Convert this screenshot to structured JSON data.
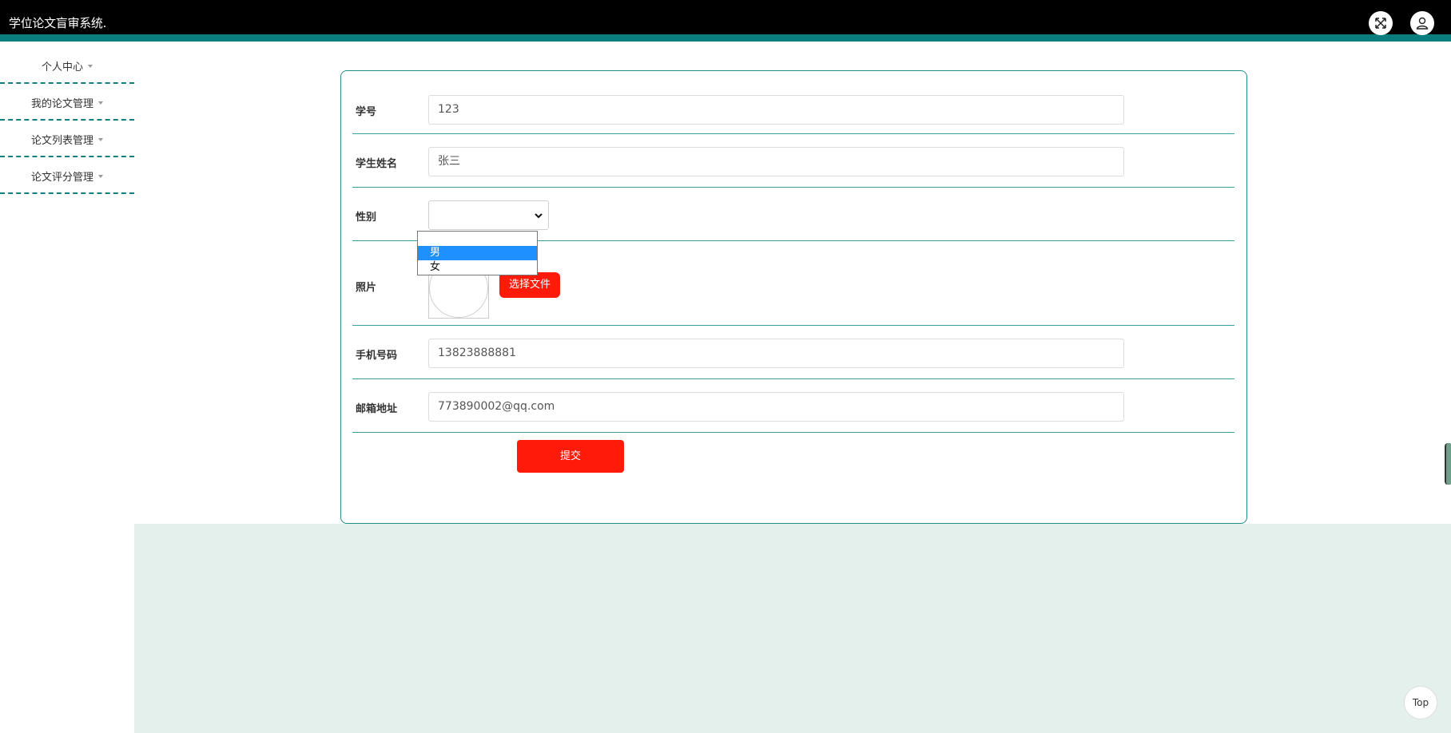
{
  "header": {
    "title": "学位论文盲审系统.",
    "icons": [
      "fullscreen-icon",
      "user-icon"
    ]
  },
  "sidebar": {
    "items": [
      {
        "label": "个人中心"
      },
      {
        "label": "我的论文管理"
      },
      {
        "label": "论文列表管理"
      },
      {
        "label": "论文评分管理"
      }
    ]
  },
  "form": {
    "student_id": {
      "label": "学号",
      "value": "123"
    },
    "student_name": {
      "label": "学生姓名",
      "value": "张三"
    },
    "gender": {
      "label": "性别",
      "value": "",
      "options": [
        "",
        "男",
        "女"
      ],
      "highlighted": "男"
    },
    "photo": {
      "label": "照片",
      "button_label": "选择文件"
    },
    "phone": {
      "label": "手机号码",
      "value": "13823888881"
    },
    "email": {
      "label": "邮箱地址",
      "value": "773890002@qq.com"
    },
    "submit_label": "提交"
  },
  "back_to_top_label": "Top",
  "colors": {
    "accent": "#0a7e7e",
    "button": "#ff1a0a",
    "bottom_bg": "#e3f0ec"
  }
}
